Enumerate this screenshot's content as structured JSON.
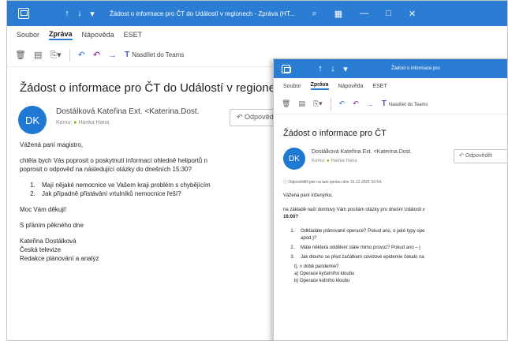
{
  "back": {
    "titlebar": {
      "title": "Žádost o informace pro ČT do Událostí v regionech - Zpráva (HT..."
    },
    "menu": [
      "Soubor",
      "Zpráva",
      "Nápověda",
      "ESET"
    ],
    "toolbar": {
      "teams": "Nasdílet do Teams"
    },
    "subject": "Žádost o informace pro ČT do Událostí v regionech",
    "sender": {
      "initials": "DK",
      "name": "Dostálková Kateřina Ext. <Katerina.Dost.",
      "to_label": "Komu:",
      "to": "Hanka Hana"
    },
    "reply": "Odpovědět",
    "body": {
      "greeting": "Vážená paní magistro,",
      "intro1": "chtěla bych Vás poprosit o poskytnutí informací ohledně heliportů n",
      "intro2": "poprosit o odpověď na následující otázky do dnešních 15:30?",
      "questions": [
        "Mají nějaké nemocnice ve Vašem kraji problém s chybějícím",
        "Jak případně přistávání vrtulníků nemocnice řeší?"
      ],
      "thanks": "Moc Vám děkuji!",
      "regards": "S přáním pěkného dne",
      "sig": [
        "Kateřina Dostálková",
        "Česká televize",
        "Redakce plánování a analýz"
      ]
    }
  },
  "front": {
    "menu": [
      "Soubor",
      "Zpráva",
      "Nápověda",
      "ESET"
    ],
    "titlebar": {
      "title": "Žádost o informace pro"
    },
    "toolbar": {
      "teams": "Nasdílet do Teams"
    },
    "subject": "Žádost o informace pro ČT",
    "sender": {
      "initials": "DK",
      "name": "Dostálková Kateřina Ext. <Katerina.Dost.",
      "to_label": "Komu:",
      "to": "Hanka Hana"
    },
    "reply": "Odpovědět",
    "info": "Odpověděli jste na tuto zprávu dne 31.12.2021 10:54.",
    "body": {
      "greeting": "Vážená paní inženýrko,",
      "intro": "na základě naší domluvy Vám posílám otázky pro dnešní Události v",
      "time": "16:00?",
      "questions": [
        "Odkládáte plánované operace? Pokud ano, o jaké typy ope",
        "Máte některá oddělení stále mimo provoz? Pokud ano – j",
        "Jak dlouho se před začátkem covidové epidemie čekalo na"
      ],
      "q1_cont": "apod.)?",
      "sub": [
        "t), v době pandemie?",
        "a) Operace kyčelního kloubu",
        "b) Operace kolního kloubu"
      ]
    }
  },
  "colors": {
    "titlebar": "#2b7cd3",
    "avatar": "#1f78d1",
    "presence": "#6bb700"
  }
}
